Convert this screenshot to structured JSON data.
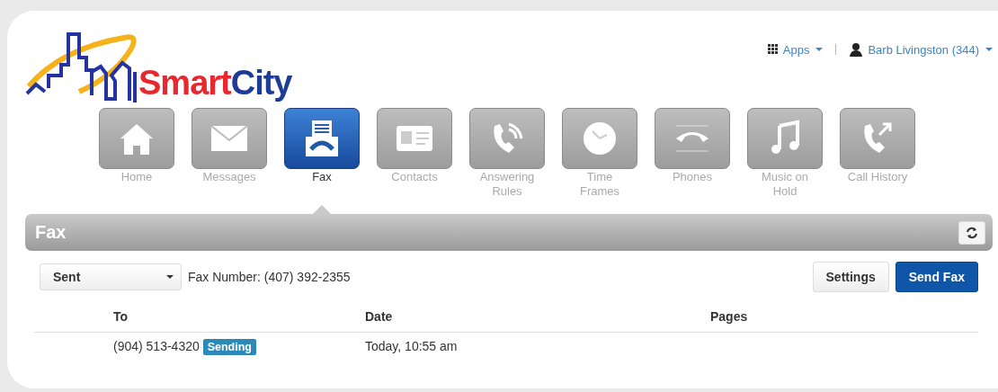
{
  "logo": {
    "word_1": "Smart",
    "word_2": "City"
  },
  "top_links": {
    "apps": "Apps",
    "user": "Barb Livingston (344)"
  },
  "nav": [
    {
      "label": "Home",
      "selected": false
    },
    {
      "label": "Messages",
      "selected": false
    },
    {
      "label": "Fax",
      "selected": true
    },
    {
      "label": "Contacts",
      "selected": false
    },
    {
      "label": "Answering Rules",
      "selected": false
    },
    {
      "label": "Time Frames",
      "selected": false
    },
    {
      "label": "Phones",
      "selected": false
    },
    {
      "label": "Music on Hold",
      "selected": false
    },
    {
      "label": "Call History",
      "selected": false
    }
  ],
  "panel": {
    "title": "Fax"
  },
  "toolbar": {
    "folder": "Sent",
    "fax_number": "Fax Number: (407) 392-2355",
    "settings": "Settings",
    "send": "Send Fax"
  },
  "table": {
    "columns": [
      "To",
      "Date",
      "Pages"
    ],
    "rows": [
      {
        "to": "(904) 513-4320",
        "status": "Sending",
        "date": "Today, 10:55 am"
      }
    ]
  }
}
